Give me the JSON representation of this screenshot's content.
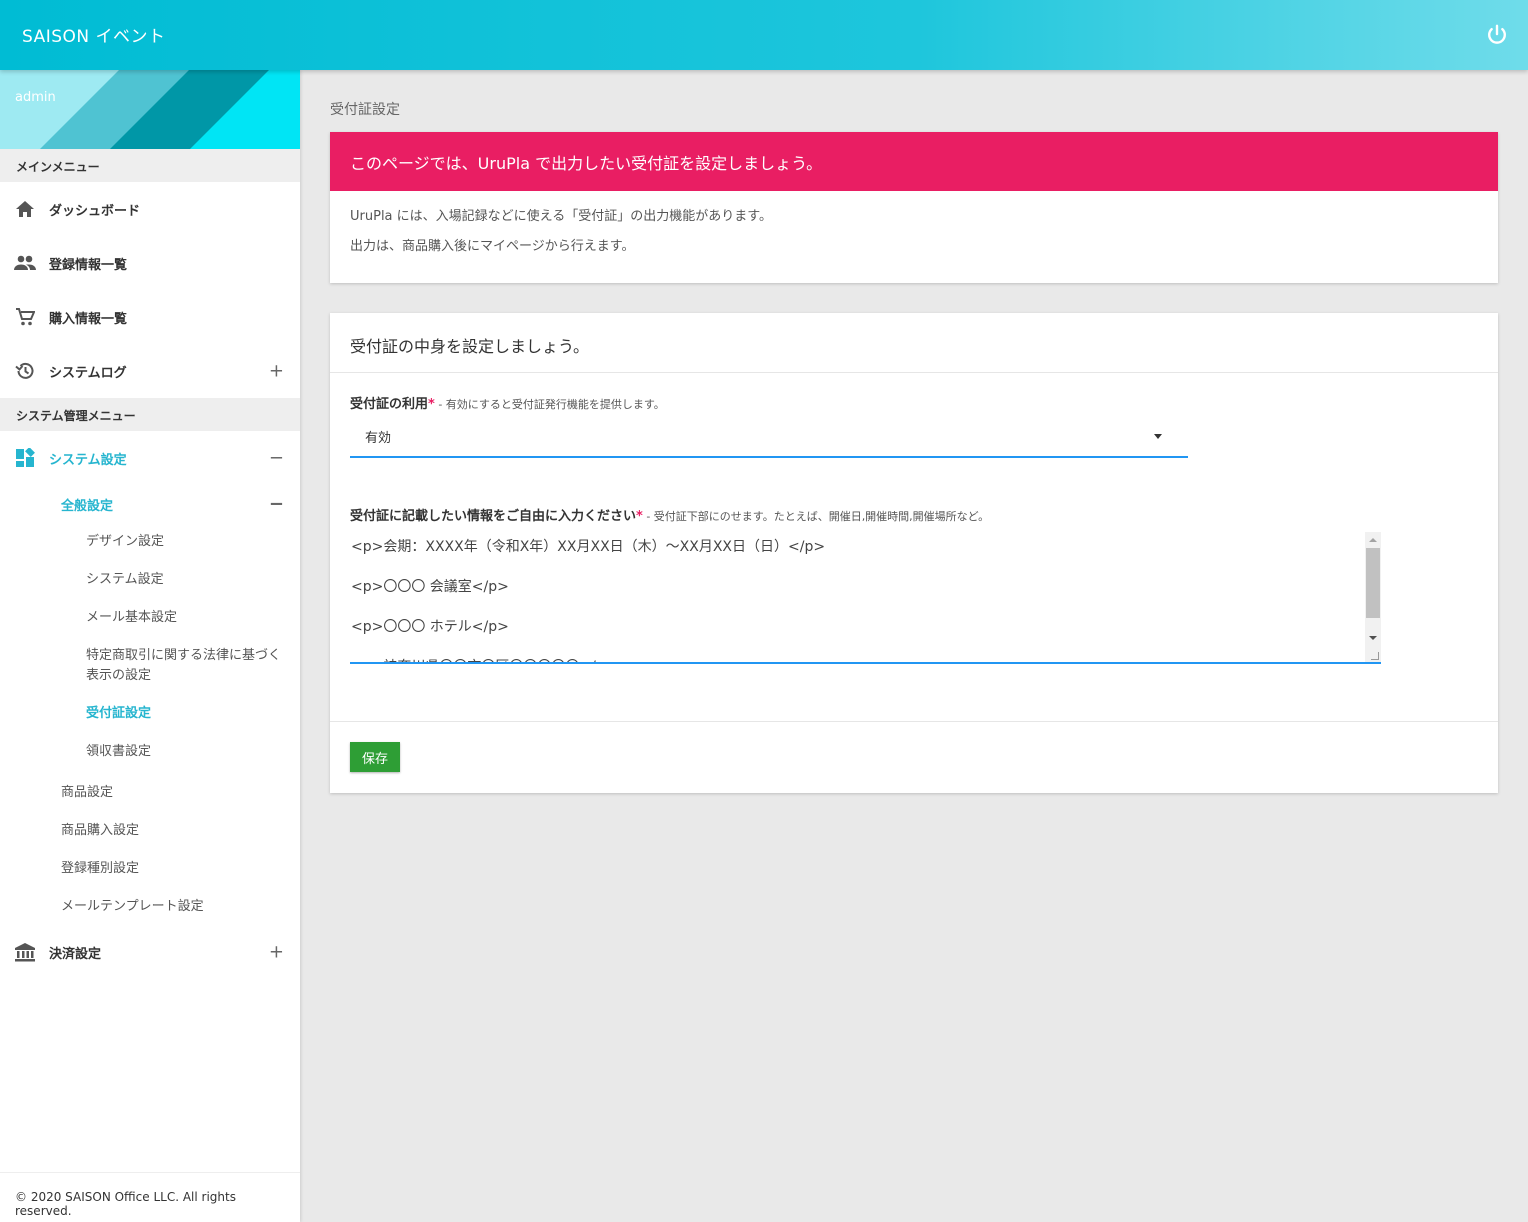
{
  "header": {
    "title": "SAISON イベント",
    "power_icon": "power-icon"
  },
  "sidebar": {
    "user": "admin",
    "main_menu_label": "メインメニュー",
    "main_items": [
      {
        "label": "ダッシュボード",
        "icon": "home-icon"
      },
      {
        "label": "登録情報一覧",
        "icon": "people-icon"
      },
      {
        "label": "購入情報一覧",
        "icon": "cart-icon"
      },
      {
        "label": "システムログ",
        "icon": "history-icon",
        "toggle": "+"
      }
    ],
    "admin_menu_label": "システム管理メニュー",
    "system_settings": {
      "label": "システム設定",
      "icon": "dashboard-icon",
      "toggle": "−"
    },
    "general_settings": {
      "label": "全般設定",
      "toggle": "−"
    },
    "general_children": [
      "デザイン設定",
      "システム設定",
      "メール基本設定",
      "特定商取引に関する法律に基づく表示の設定",
      "受付証設定",
      "領収書設定"
    ],
    "other_settings": [
      "商品設定",
      "商品購入設定",
      "登録種別設定",
      "メールテンプレート設定"
    ],
    "payment_settings": {
      "label": "決済設定",
      "icon": "bank-icon",
      "toggle": "+"
    },
    "footer": "© 2020 SAISON Office LLC. All rights reserved."
  },
  "main": {
    "page_title": "受付証設定",
    "alert": {
      "title": "このページでは、UruPla で出力したい受付証を設定しましょう。",
      "line1": "UruPla には、入場記録などに使える「受付証」の出力機能があります。",
      "line2": "出力は、商品購入後にマイページから行えます。"
    },
    "form": {
      "title": "受付証の中身を設定しましょう。",
      "use_label": "受付証の利用",
      "required_mark": "*",
      "use_hint": " - 有効にすると受付証発行機能を提供します。",
      "use_value": "有効",
      "info_label": "受付証に記載したい情報をご自由に入力ください",
      "info_hint": " - 受付証下部にのせます。たとえば、開催日,開催時間,開催場所など。",
      "info_lines": [
        "<p>会期：XXXX年（令和X年）XX月XX日（木）～XX月XX日（日）</p>",
        "<p>〇〇〇 会議室</p>",
        "<p>〇〇〇 ホテル</p>",
        "<p>神奈川県〇〇市〇区〇〇〇〇〇</p>"
      ],
      "save_label": "保存"
    }
  },
  "colors": {
    "accent": "#26b5cf",
    "alert": "#e91e63",
    "save": "#2e9e35",
    "focus": "#2196f3"
  }
}
